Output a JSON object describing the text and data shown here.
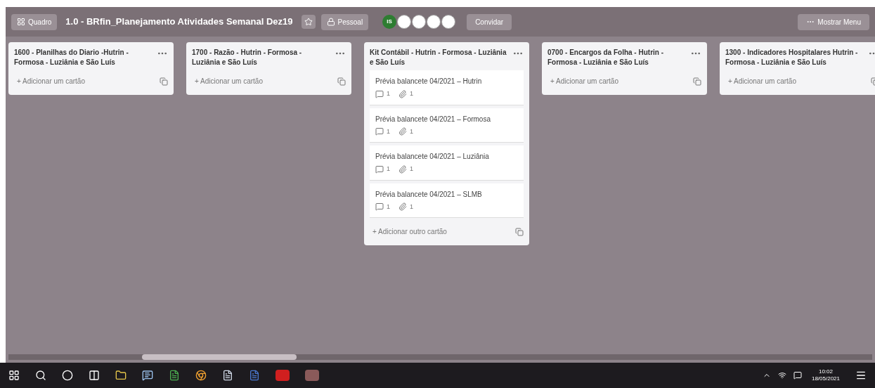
{
  "header": {
    "board_button": "Quadro",
    "title": "1.0 - BRfin_Planejamento Atividades Semanal Dez19",
    "visibility": "Pessoal",
    "member_initials": "IS",
    "invite": "Convidar",
    "menu": "Mostrar Menu"
  },
  "lists": [
    {
      "title": "1600 - Planilhas do Diario -Hutrin - Formosa - Luziânia e São Luís",
      "add": "+ Adicionar um cartão"
    },
    {
      "title": "1700 - Razão - Hutrin - Formosa - Luziânia e São Luís",
      "add": "+ Adicionar um cartão"
    },
    {
      "title": "Kit Contábil - Hutrin - Formosa - Luziânia e São Luís",
      "cards": [
        {
          "title": "Prévia balancete 04/2021 – Hutrin",
          "comments": "1",
          "attachments": "1"
        },
        {
          "title": "Prévia balancete 04/2021 – Formosa",
          "comments": "1",
          "attachments": "1"
        },
        {
          "title": "Prévia balancete 04/2021 – Luziânia",
          "comments": "1",
          "attachments": "1"
        },
        {
          "title": "Prévia balancete 04/2021 – SLMB",
          "comments": "1",
          "attachments": "1"
        }
      ],
      "add": "+ Adicionar outro cartão"
    },
    {
      "title": "0700 - Encargos da Folha - Hutrin - Formosa - Luziânia e São Luís",
      "add": "+ Adicionar um cartão"
    },
    {
      "title": "1300 - Indicadores Hospitalares Hutrin - Formosa - Luziânia e São Luís",
      "add": "+ Adicionar um cartão"
    }
  ],
  "taskbar": {
    "time": "10:02",
    "date": "18/05/2021"
  }
}
